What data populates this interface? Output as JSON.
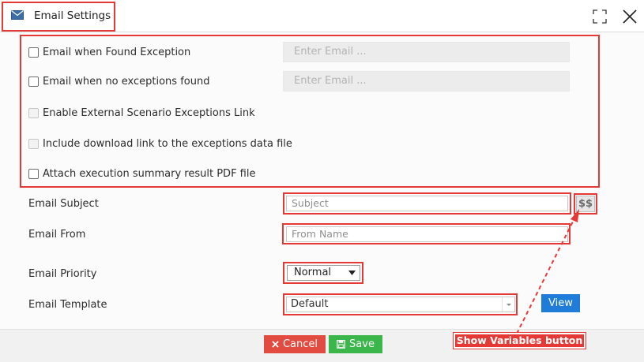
{
  "window": {
    "title": "Email Settings",
    "title_icon": "envelope-icon"
  },
  "checkboxes": [
    {
      "label": "Email when Found Exception",
      "checked": false,
      "disabled": false
    },
    {
      "label": "Email when no exceptions found",
      "checked": false,
      "disabled": false
    },
    {
      "label": "Enable External Scenario Exceptions Link",
      "checked": false,
      "disabled": true
    },
    {
      "label": "Include download link to the exceptions data file",
      "checked": false,
      "disabled": true
    },
    {
      "label": "Attach execution summary result PDF file",
      "checked": false,
      "disabled": false
    }
  ],
  "email_inputs": [
    {
      "placeholder": "Enter Email ..."
    },
    {
      "placeholder": "Enter Email ..."
    }
  ],
  "fields": {
    "subject": {
      "label": "Email Subject",
      "placeholder": "Subject"
    },
    "from": {
      "label": "Email From",
      "placeholder": "From Name"
    },
    "priority": {
      "label": "Email Priority",
      "value": "Normal"
    },
    "template": {
      "label": "Email Template",
      "value": "Default"
    }
  },
  "buttons": {
    "variables": "$$",
    "view": "View",
    "cancel": "Cancel",
    "save": "Save"
  },
  "annotation": {
    "callout": "Show Variables button",
    "color": "#e53935"
  },
  "colors": {
    "highlight": "#e53935",
    "view_button": "#1f7cd8",
    "cancel_button": "#e24b3f",
    "save_button": "#3bb64a"
  }
}
